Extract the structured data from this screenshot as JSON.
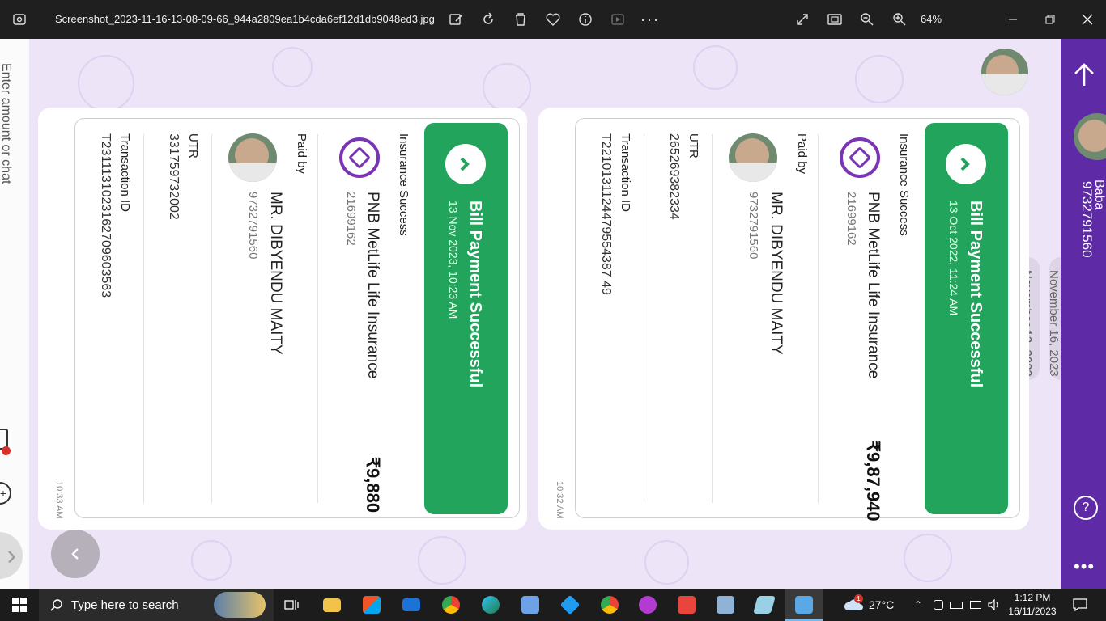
{
  "titlebar": {
    "filename": "Screenshot_2023-11-16-13-08-09-66_944a2809ea1b4cda6ef12d1db9048ed3.jpg",
    "zoom": "64%"
  },
  "left_strip": {
    "clipped_text": "Enter amount or chat"
  },
  "right_panel": {
    "clipped_name": "Baba",
    "phone": "9732791560"
  },
  "date_chip": {
    "label": "November 13, 2023",
    "clipped_label": "November 16, 2023"
  },
  "cards": [
    {
      "status": "Bill Payment Successful",
      "datetime": "13 Oct 2022, 11:24 AM",
      "category": "Insurance Success",
      "biller": "PNB MetLife Life Insurance",
      "biller_id": "21699162",
      "amount": "₹9,87,940",
      "paid_by_label": "Paid by",
      "payer_name": "MR. DIBYENDU MAITY",
      "payer_phone": "9732791560",
      "utr_label": "UTR",
      "utr": "265269382334",
      "txn_label": "Transaction ID",
      "txn_id": "T2210131124479554387 49",
      "time": "10:32 AM"
    },
    {
      "status": "Bill Payment Successful",
      "datetime": "13 Nov 2023, 10:23 AM",
      "category": "Insurance Success",
      "biller": "PNB MetLife Life Insurance",
      "biller_id": "21699162",
      "amount": "₹9,880",
      "paid_by_label": "Paid by",
      "payer_name": "MR. DIBYENDU MAITY",
      "payer_phone": "9732791560",
      "utr_label": "UTR",
      "utr": "331759732002",
      "txn_label": "Transaction ID",
      "txn_id": "T2311131023162709603563",
      "time": "10:33 AM"
    }
  ],
  "taskbar": {
    "search_placeholder": "Type here to search",
    "weather": "27°C",
    "weather_badge": "1",
    "time": "1:12 PM",
    "date": "16/11/2023"
  },
  "colors": {
    "accent_green": "#22a45d",
    "brand_purple": "#5e2aa6",
    "chat_bg": "#ede4f7"
  }
}
